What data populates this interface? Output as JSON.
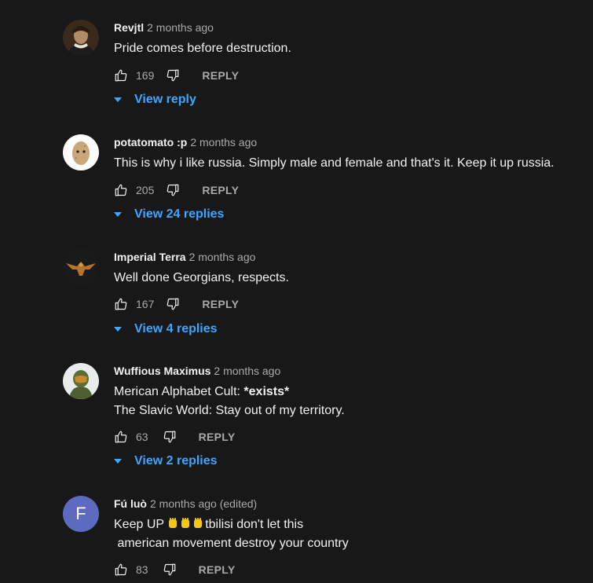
{
  "comments": [
    {
      "author": "Revjtl",
      "time": "2 months ago",
      "lines": [
        "Pride comes before destruction."
      ],
      "likes": "169",
      "reply_label": "REPLY",
      "view_replies": "View reply",
      "avatar_icon": "portrait-avatar-icon"
    },
    {
      "author": "potatomato :p",
      "time": "2 months ago",
      "lines": [
        "This is why i like russia. Simply male and female and that's it. Keep it up russia."
      ],
      "likes": "205",
      "reply_label": "REPLY",
      "view_replies": "View 24 replies",
      "avatar_icon": "potato-avatar-icon"
    },
    {
      "author": "Imperial Terra",
      "time": "2 months ago",
      "lines": [
        "Well done Georgians, respects."
      ],
      "likes": "167",
      "reply_label": "REPLY",
      "view_replies": "View 4 replies",
      "avatar_icon": "eagle-avatar-icon"
    },
    {
      "author": "Wuffious Maximus",
      "time": "2 months ago",
      "lines": [
        "Merican Alphabet Cult: ",
        "*exists*",
        "The Slavic World: Stay out of my territory."
      ],
      "likes": "63",
      "reply_label": "REPLY",
      "view_replies": "View 2 replies",
      "avatar_icon": "helmet-avatar-icon"
    },
    {
      "author": "Fú luò",
      "time": "2 months ago (edited)",
      "avatar_letter": "F",
      "lines": [
        "Keep UP ",
        "tbilisi don't let this",
        " american movement destroy your country"
      ],
      "likes": "83",
      "reply_label": "REPLY",
      "avatar_icon": "letter-avatar"
    }
  ],
  "colors": {
    "background": "#181818",
    "link_blue": "#3ea6ff",
    "secondary_text": "#aaaaaa",
    "avatar_letter_bg": "#5c6bc0"
  }
}
